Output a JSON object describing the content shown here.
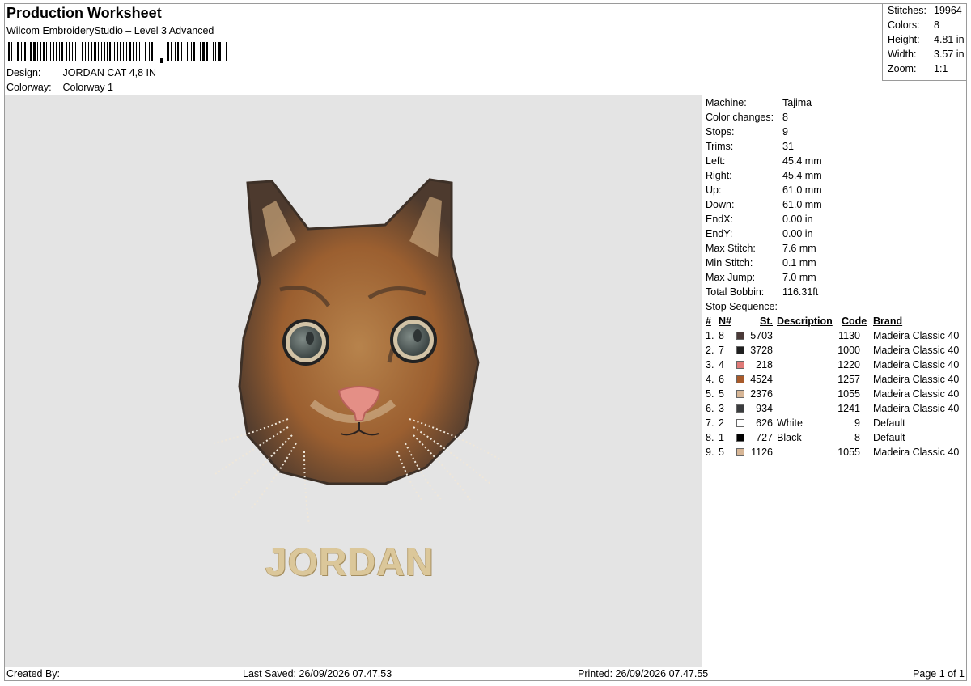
{
  "header": {
    "title": "Production Worksheet",
    "software": "Wilcom EmbroideryStudio – Level 3 Advanced",
    "design_label": "Design:",
    "design_value": "JORDAN CAT 4,8 IN",
    "colorway_label": "Colorway:",
    "colorway_value": "Colorway 1"
  },
  "stats": [
    {
      "label": "Stitches:",
      "value": "19964"
    },
    {
      "label": "Colors:",
      "value": "8"
    },
    {
      "label": "Height:",
      "value": "4.81 in"
    },
    {
      "label": "Width:",
      "value": "3.57 in"
    },
    {
      "label": "Zoom:",
      "value": "1:1"
    }
  ],
  "design_preview": {
    "name_text": "JORDAN"
  },
  "machine_info": [
    {
      "label": "Machine:",
      "value": "Tajima"
    },
    {
      "label": "Color changes:",
      "value": "8"
    },
    {
      "label": "Stops:",
      "value": "9"
    },
    {
      "label": "Trims:",
      "value": "31"
    },
    {
      "label": "Left:",
      "value": "45.4 mm"
    },
    {
      "label": "Right:",
      "value": "45.4 mm"
    },
    {
      "label": "Up:",
      "value": "61.0 mm"
    },
    {
      "label": "Down:",
      "value": "61.0 mm"
    },
    {
      "label": "EndX:",
      "value": "0.00 in"
    },
    {
      "label": "EndY:",
      "value": "0.00 in"
    },
    {
      "label": "Max Stitch:",
      "value": "7.6 mm"
    },
    {
      "label": "Min Stitch:",
      "value": "0.1 mm"
    },
    {
      "label": "Max Jump:",
      "value": "7.0 mm"
    },
    {
      "label": "Total Bobbin:",
      "value": "116.31ft"
    }
  ],
  "stop_sequence": {
    "label": "Stop Sequence:",
    "headers": {
      "num": "#",
      "n": "N#",
      "st": "St.",
      "desc": "Description",
      "code": "Code",
      "brand": "Brand"
    },
    "rows": [
      {
        "num": "1.",
        "n": "8",
        "color": "#4a3a38",
        "st": "5703",
        "desc": "",
        "code": "1130",
        "brand": "Madeira Classic 40"
      },
      {
        "num": "2.",
        "n": "7",
        "color": "#1f1f1f",
        "st": "3728",
        "desc": "",
        "code": "1000",
        "brand": "Madeira Classic 40"
      },
      {
        "num": "3.",
        "n": "4",
        "color": "#e07a78",
        "st": "218",
        "desc": "",
        "code": "1220",
        "brand": "Madeira Classic 40"
      },
      {
        "num": "4.",
        "n": "6",
        "color": "#a85a2a",
        "st": "4524",
        "desc": "",
        "code": "1257",
        "brand": "Madeira Classic 40"
      },
      {
        "num": "5.",
        "n": "5",
        "color": "#d7b696",
        "st": "2376",
        "desc": "",
        "code": "1055",
        "brand": "Madeira Classic 40"
      },
      {
        "num": "6.",
        "n": "3",
        "color": "#3a3c3e",
        "st": "934",
        "desc": "",
        "code": "1241",
        "brand": "Madeira Classic 40"
      },
      {
        "num": "7.",
        "n": "2",
        "color": "#ffffff",
        "st": "626",
        "desc": "White",
        "code": "9",
        "brand": "Default"
      },
      {
        "num": "8.",
        "n": "1",
        "color": "#000000",
        "st": "727",
        "desc": "Black",
        "code": "8",
        "brand": "Default"
      },
      {
        "num": "9.",
        "n": "5",
        "color": "#d7b696",
        "st": "1126",
        "desc": "",
        "code": "1055",
        "brand": "Madeira Classic 40"
      }
    ]
  },
  "footer": {
    "created_by": "Created By:",
    "last_saved": "Last Saved: 26/09/2026 07.47.53",
    "printed": "Printed: 26/09/2026 07.47.55",
    "page": "Page 1 of 1"
  }
}
